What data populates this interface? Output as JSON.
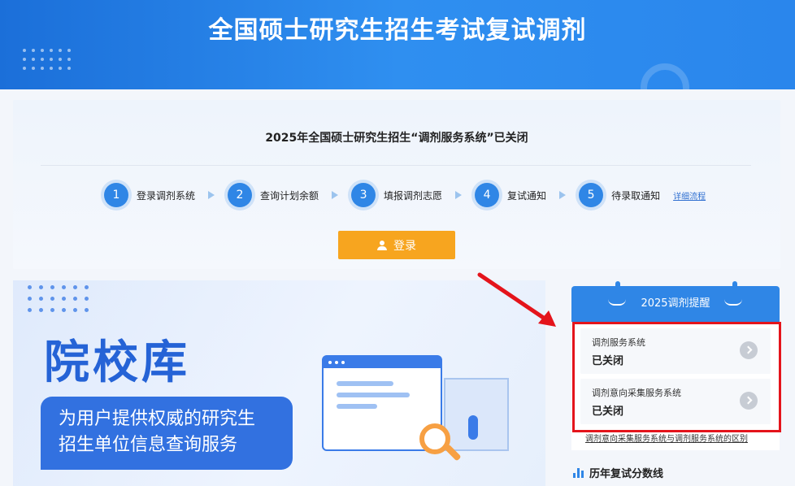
{
  "header": {
    "title": "全国硕士研究生招生考试复试调剂"
  },
  "panel": {
    "title": "2025年全国硕士研究生招生“调剂服务系统”已关闭",
    "steps": [
      {
        "num": "1",
        "label": "登录调剂系统"
      },
      {
        "num": "2",
        "label": "查询计划余额"
      },
      {
        "num": "3",
        "label": "填报调剂志愿"
      },
      {
        "num": "4",
        "label": "复试通知"
      },
      {
        "num": "5",
        "label": "待录取通知"
      }
    ],
    "detail_link": "详细流程",
    "login_label": "登录"
  },
  "banner": {
    "title": "院校库",
    "subtitle_line1": "为用户提供权威的研究生",
    "subtitle_line2": "招生单位信息查询服务"
  },
  "reminder": {
    "title": "2025调剂提醒",
    "items": [
      {
        "name": "调剂服务系统",
        "status": "已关闭"
      },
      {
        "name": "调剂意向采集服务系统",
        "status": "已关闭"
      }
    ],
    "diff_link": "调剂意向采集服务系统与调剂服务系统的区别"
  },
  "scores": {
    "title": "历年复试分数线"
  },
  "colors": {
    "primary": "#2f86e6",
    "accent": "#f7a51f",
    "highlight": "#e4141b"
  }
}
